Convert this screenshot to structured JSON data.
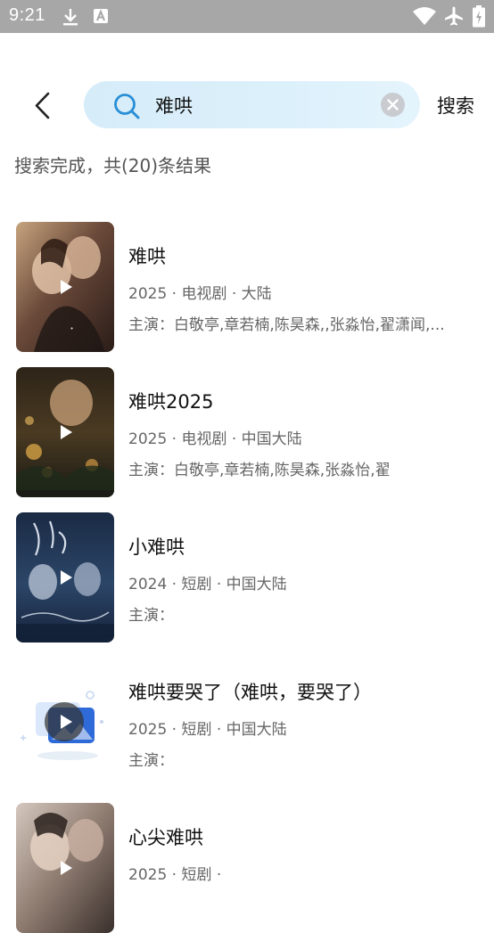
{
  "status_bar": {
    "time": "9:21",
    "icons": [
      "download-icon",
      "notification-a-icon",
      "wifi-icon",
      "airplane-icon",
      "battery-icon"
    ]
  },
  "search": {
    "query": "难哄",
    "button_label": "搜索"
  },
  "results": {
    "summary": "搜索完成，共(20)条结果",
    "items": [
      {
        "title": "难哄",
        "meta": "2025 · 电视剧 · 大陆",
        "cast": "主演：白敬亭,章若楠,陈昊森,,张淼怡,翟潇闻,..."
      },
      {
        "title": "难哄2025",
        "meta": "2025 · 电视剧 · 中国大陆",
        "cast": "主演：白敬亭,章若楠,陈昊森,张淼怡,翟"
      },
      {
        "title": "小难哄",
        "meta": "2024 · 短剧 · 中国大陆",
        "cast": "主演："
      },
      {
        "title": "难哄要哭了（难哄，要哭了）",
        "meta": "2025 · 短剧 · 中国大陆",
        "cast": "主演："
      },
      {
        "title": "心尖难哄",
        "meta": "2025 · 短剧 · ",
        "cast": ""
      }
    ]
  },
  "colors": {
    "status_bar_bg": "#a7a7a7",
    "search_box_bg": "#dbeffa",
    "search_icon": "#2a8fd6",
    "clear_icon_bg": "#c8ccd0"
  }
}
